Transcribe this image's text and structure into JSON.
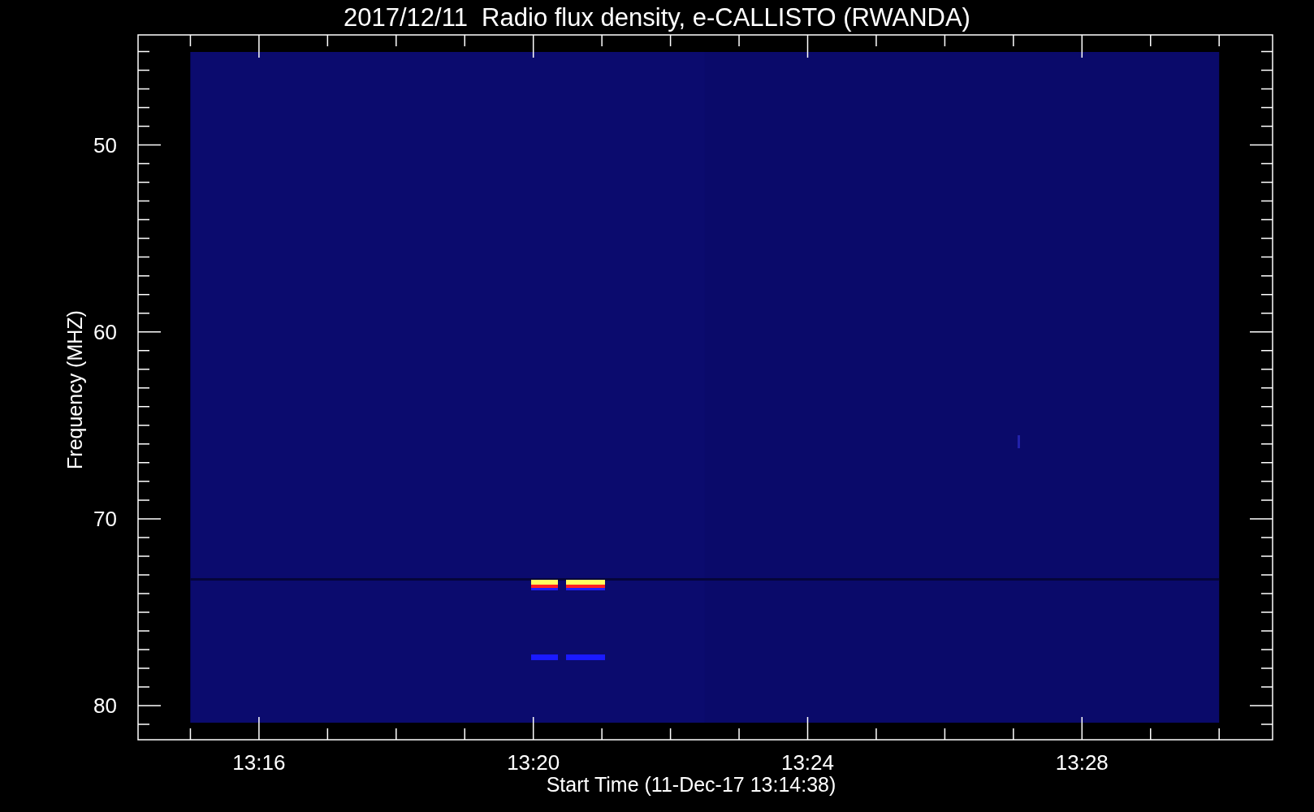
{
  "title": "2017/12/11  Radio flux density, e-CALLISTO (RWANDA)",
  "y_axis": {
    "label": "Frequency (MHZ)",
    "ticks": [
      "50",
      "60",
      "70",
      "80"
    ]
  },
  "x_axis": {
    "label": "Start Time (11-Dec-17 13:14:38)",
    "ticks": [
      "13:16",
      "13:20",
      "13:24",
      "13:28"
    ]
  }
}
